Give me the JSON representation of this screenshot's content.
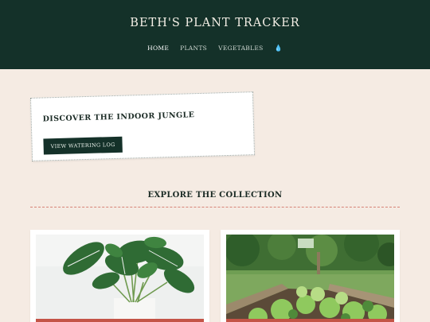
{
  "header": {
    "title": "BETH'S PLANT TRACKER",
    "nav": [
      {
        "label": "HOME",
        "active": true
      },
      {
        "label": "PLANTS",
        "active": false
      },
      {
        "label": "VEGETABLES",
        "active": false
      }
    ],
    "water_icon": "water-drop-icon"
  },
  "hero": {
    "title": "DISCOVER THE INDOOR JUNGLE",
    "button_label": "VIEW WATERING LOG"
  },
  "collection": {
    "title": "EXPLORE THE COLLECTION",
    "cards": [
      {
        "image": "monstera-plant-photo"
      },
      {
        "image": "raised-garden-bed-photo"
      }
    ]
  },
  "colors": {
    "header_bg": "#143129",
    "page_bg": "#f5ebe3",
    "accent": "#c45447"
  }
}
